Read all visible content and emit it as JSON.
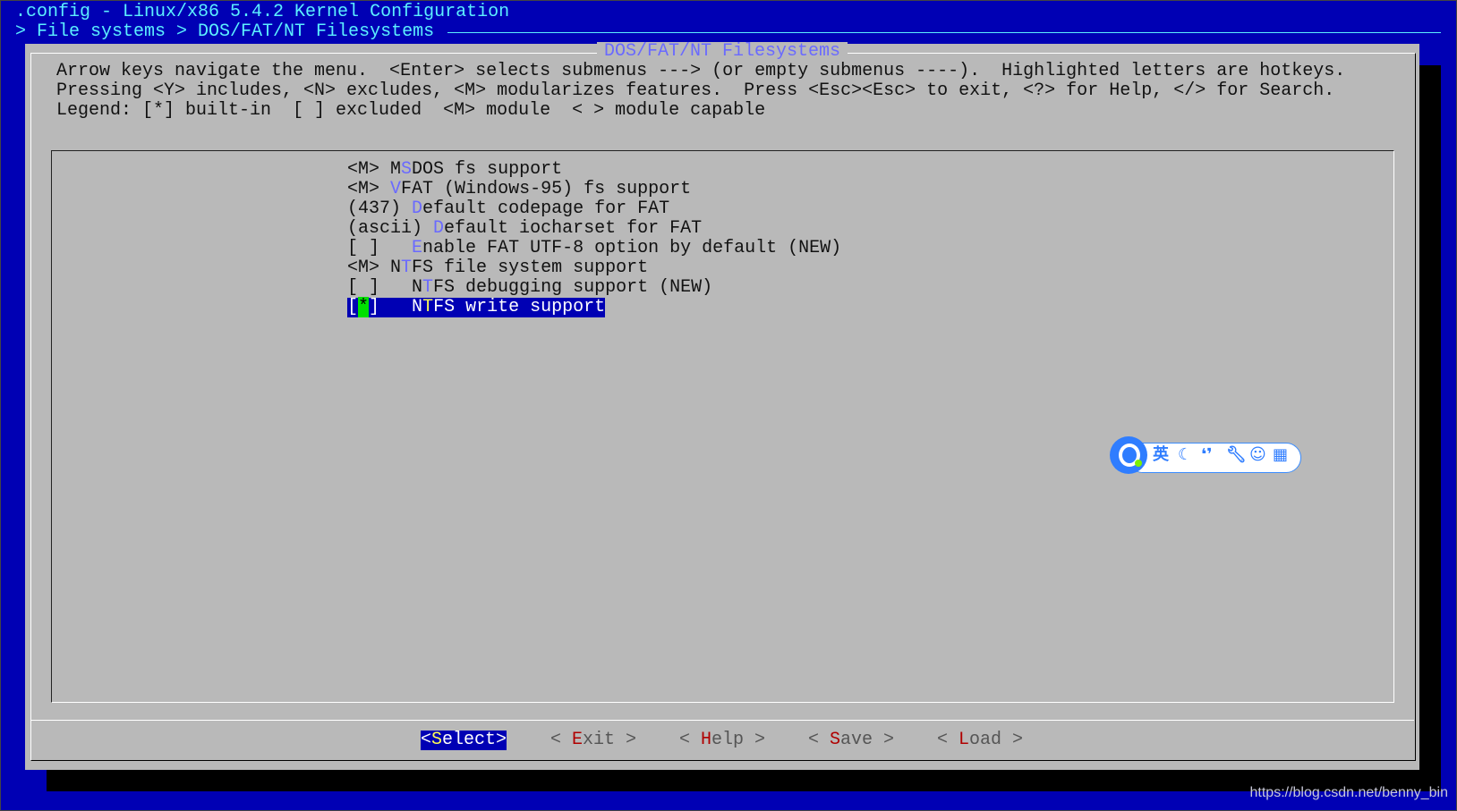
{
  "header": {
    "title": ".config - Linux/x86 5.4.2 Kernel Configuration",
    "breadcrumb": "> File systems > DOS/FAT/NT Filesystems"
  },
  "dialog": {
    "title": "DOS/FAT/NT Filesystems",
    "help_lines": [
      "Arrow keys navigate the menu.  <Enter> selects submenus ---> (or empty submenus ----).  Highlighted letters are hotkeys.",
      "Pressing <Y> includes, <N> excludes, <M> modularizes features.  Press <Esc><Esc> to exit, <?> for Help, </> for Search.",
      "Legend: [*] built-in  [ ] excluded  <M> module  < > module capable"
    ]
  },
  "menu": {
    "items": [
      {
        "state": "<M>",
        "pre": " M",
        "hotkey": "S",
        "post": "DOS fs support"
      },
      {
        "state": "<M>",
        "pre": " ",
        "hotkey": "V",
        "post": "FAT (Windows-95) fs support"
      },
      {
        "state": "(437)",
        "pre": " ",
        "hotkey": "D",
        "post": "efault codepage for FAT"
      },
      {
        "state": "(ascii)",
        "pre": " ",
        "hotkey": "D",
        "post": "efault iocharset for FAT"
      },
      {
        "state": "[ ]",
        "pre": "   ",
        "hotkey": "E",
        "post": "nable FAT UTF-8 option by default (NEW)"
      },
      {
        "state": "<M>",
        "pre": " N",
        "hotkey": "T",
        "post": "FS file system support"
      },
      {
        "state": "[ ]",
        "pre": "   N",
        "hotkey": "T",
        "post": "FS debugging support (NEW)"
      }
    ],
    "selected": {
      "bracket_open": "[",
      "mark": "*",
      "bracket_close": "]",
      "pre": "   N",
      "hotkey": "T",
      "post": "FS write support"
    }
  },
  "buttons": [
    {
      "open": "<",
      "hotkey": "S",
      "rest": "elect",
      "close": ">",
      "active": true
    },
    {
      "open": "< ",
      "hotkey": "E",
      "rest": "xit",
      "close": " >"
    },
    {
      "open": "< ",
      "hotkey": "H",
      "rest": "elp",
      "close": " >"
    },
    {
      "open": "< ",
      "hotkey": "S",
      "rest": "ave",
      "close": " >"
    },
    {
      "open": "< ",
      "hotkey": "L",
      "rest": "oad",
      "close": " >"
    }
  ],
  "ime_toolbar": {
    "lang_label": "英",
    "icons": [
      "ime-logo-icon",
      "moon-icon",
      "punctuation-icon",
      "wrench-icon",
      "emoji-icon",
      "grid-icon"
    ]
  },
  "watermark": "https://blog.csdn.net/benny_bin",
  "colors": {
    "background": "#0000b4",
    "dialog": "#b9b9b9",
    "hotkey": "#6a6aff",
    "button_hotkey": "#b00000",
    "checked_mark": "#00e000"
  }
}
